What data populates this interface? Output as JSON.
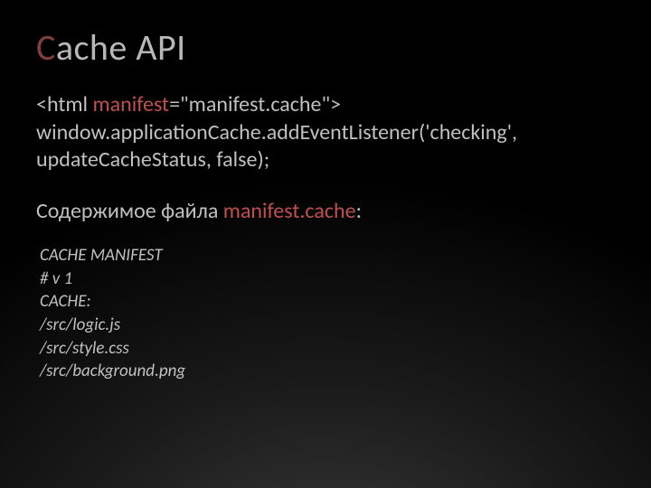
{
  "title": {
    "accent_first_letter": "C",
    "rest": "ache API"
  },
  "code": {
    "open_tag": "<html ",
    "attr_name": "manifest",
    "attr_rest": "=\"manifest.cache\">",
    "js_line1": "window.applicationCache.addEventListener('checking',",
    "js_line2": "updateCacheStatus, false);"
  },
  "subheading": {
    "prefix": "Содержимое файла ",
    "filename": "manifest.cache",
    "suffix": ":"
  },
  "manifest_file": {
    "l1": "CACHE MANIFEST",
    "l2": "# v 1",
    "l3": "CACHE:",
    "l4": "/src/logic.js",
    "l5": "/src/style.css",
    "l6": "/src/background.png"
  }
}
